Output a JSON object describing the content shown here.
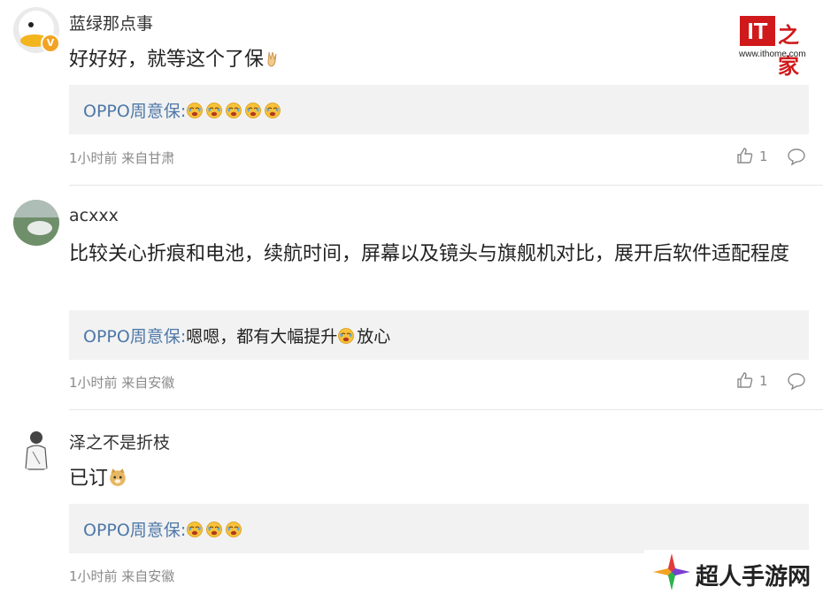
{
  "logo": {
    "brand": "IT",
    "brand_cn": "之家",
    "url": "www.ithome.com"
  },
  "watermark": {
    "text": "超人手游网"
  },
  "comments": [
    {
      "username": "蓝绿那点事",
      "verified_badge": "V",
      "content": "好好好，就等这个了保",
      "content_emoji": "victory-hand",
      "reply": {
        "author": "OPPO周意保",
        "sep": ":",
        "body": "",
        "emoji_count": 5
      },
      "meta": "1小时前 来自甘肃",
      "likes": "1"
    },
    {
      "username": "acxxx",
      "content": "比较关心折痕和电池，续航时间，屏幕以及镜头与旗舰机对比，展开后软件适配程度",
      "reply": {
        "author": "OPPO周意保",
        "sep": ":",
        "body": "嗯嗯，都有大幅提升",
        "body_after": "放心",
        "emoji_count": 1
      },
      "meta": "1小时前 来自安徽",
      "likes": "1"
    },
    {
      "username": "泽之不是折枝",
      "content": "已订",
      "content_emoji": "doge",
      "reply": {
        "author": "OPPO周意保",
        "sep": ":",
        "body": "",
        "emoji_count": 3
      },
      "meta": "1小时前 来自安徽"
    }
  ]
}
